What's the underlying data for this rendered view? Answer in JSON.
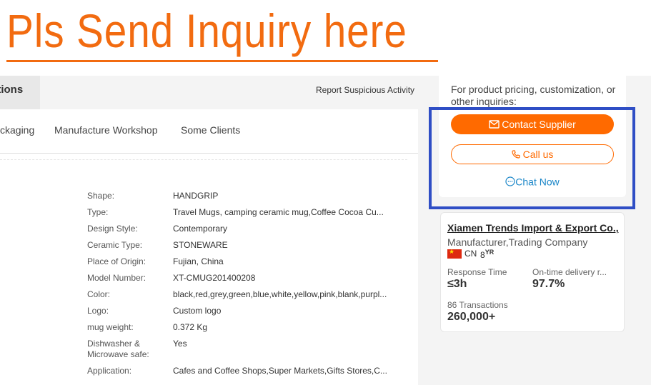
{
  "banner": {
    "text": "Pls Send Inquiry here"
  },
  "top_bar": {
    "active_tab": "ctions",
    "report_link": "Report Suspicious Activity"
  },
  "subnav": {
    "items": [
      "ckaging",
      "Manufacture Workshop",
      "Some Clients"
    ]
  },
  "attributes": [
    {
      "label": "Shape:",
      "value": "HANDGRIP"
    },
    {
      "label": "Type:",
      "value": "Travel Mugs, camping ceramic mug,Coffee Cocoa Cu..."
    },
    {
      "label": "Design Style:",
      "value": "Contemporary"
    },
    {
      "label": "Ceramic Type:",
      "value": "STONEWARE"
    },
    {
      "label": "Place of Origin:",
      "value": "Fujian, China"
    },
    {
      "label": "Model Number:",
      "value": "XT-CMUG201400208"
    },
    {
      "label": "Color:",
      "value": "black,red,grey,green,blue,white,yellow,pink,blank,purpl..."
    },
    {
      "label": "Logo:",
      "value": "Custom logo"
    },
    {
      "label": "mug weight:",
      "value": "0.372 Kg"
    },
    {
      "label": "Dishwasher & Microwave safe:",
      "value": "Yes"
    },
    {
      "label": "Application:",
      "value": "Cafes and Coffee Shops,Super Markets,Gifts Stores,C..."
    }
  ],
  "inquiry": {
    "prompt": "For product pricing, customization, or other inquiries:",
    "contact_label": "Contact Supplier",
    "call_label": "Call us",
    "chat_label": "Chat Now"
  },
  "supplier": {
    "name": "Xiamen Trends Import & Export Co.,...",
    "business_type": "Manufacturer,Trading Company",
    "country": "CN",
    "years_num": "8",
    "years_unit": "YR",
    "response_time_label": "Response Time",
    "response_time_value": "≤3h",
    "delivery_label": "On-time delivery r...",
    "delivery_value": "97.7%",
    "transactions_label": "86 Transactions",
    "transactions_value": "260,000+"
  },
  "colors": {
    "accent": "#ff6a00",
    "banner": "#f26b10",
    "highlight": "#2f4ec5",
    "link": "#1a86c8"
  }
}
